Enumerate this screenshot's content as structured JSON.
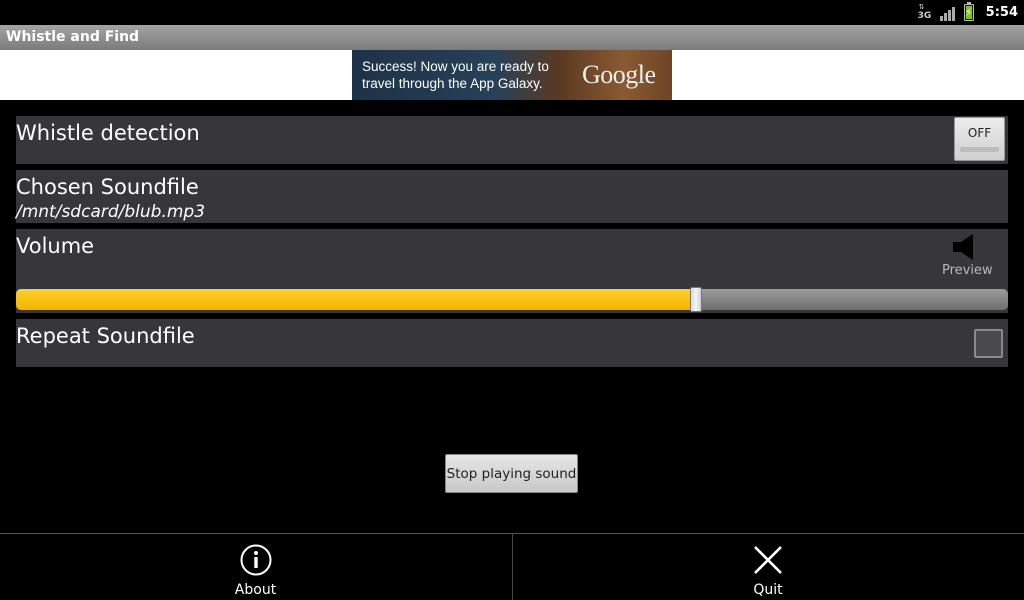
{
  "status_bar": {
    "network_label": "3G",
    "clock": "5:54",
    "battery_color": "#7cc21d"
  },
  "title_bar": {
    "title": "Whistle and Find"
  },
  "ad": {
    "line1": "Success! Now you are ready to",
    "line2": "travel through the App Galaxy.",
    "logo": "Google"
  },
  "settings": {
    "whistle_detection": {
      "label": "Whistle detection",
      "toggle_text": "OFF",
      "enabled": false
    },
    "soundfile": {
      "label": "Chosen Soundfile",
      "path": "/mnt/sdcard/blub.mp3"
    },
    "volume": {
      "label": "Volume",
      "preview_label": "Preview",
      "level_fraction": 0.685,
      "accent": "#f5b800"
    },
    "repeat": {
      "label": "Repeat Soundfile",
      "checked": false
    }
  },
  "stop_button": {
    "label": "Stop playing sound"
  },
  "menu": {
    "about": {
      "label": "About",
      "icon": "info-icon"
    },
    "quit": {
      "label": "Quit",
      "icon": "close-icon"
    }
  }
}
